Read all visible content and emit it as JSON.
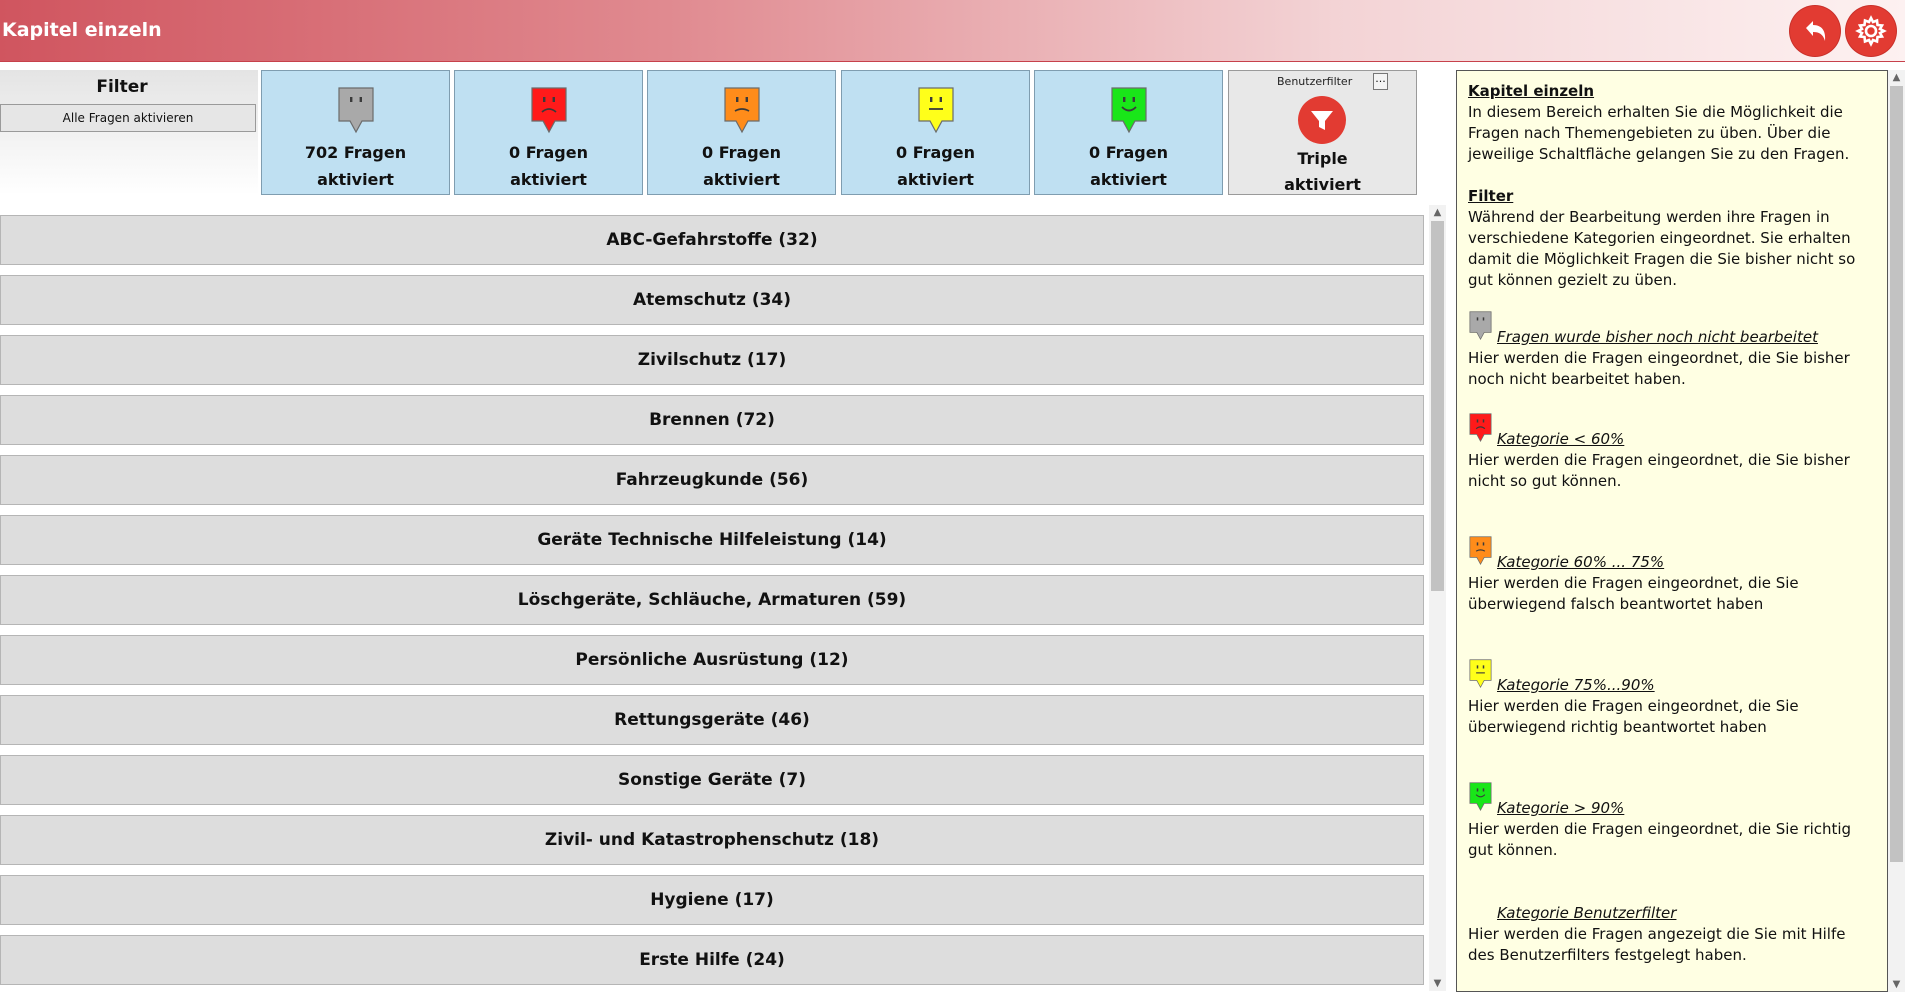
{
  "app": {
    "title": "Kapitel einzeln"
  },
  "filter": {
    "title": "Filter",
    "all_button": "Alle Fragen aktivieren",
    "tiles": [
      {
        "id": "gray",
        "color": "#a9a9a9",
        "mood": "neutral",
        "count": "702 Fragen",
        "status": "aktiviert"
      },
      {
        "id": "red",
        "color": "#ff1a1a",
        "mood": "sad",
        "count": "0 Fragen",
        "status": "aktiviert"
      },
      {
        "id": "orange",
        "color": "#ff8c1a",
        "mood": "meh",
        "count": "0 Fragen",
        "status": "aktiviert"
      },
      {
        "id": "yellow",
        "color": "#ffff1a",
        "mood": "flat",
        "count": "0 Fragen",
        "status": "aktiviert"
      },
      {
        "id": "green",
        "color": "#19e619",
        "mood": "happy",
        "count": "0 Fragen",
        "status": "aktiviert"
      }
    ],
    "user_filter": {
      "label": "Benutzerfilter",
      "more": "...",
      "count": "Triple",
      "status": "aktiviert",
      "icon": "funnel-icon"
    }
  },
  "chapters": [
    "ABC-Gefahrstoffe (32)",
    "Atemschutz (34)",
    "Zivilschutz (17)",
    "Brennen (72)",
    "Fahrzeugkunde (56)",
    "Geräte Technische Hilfeleistung (14)",
    "Löschgeräte, Schläuche, Armaturen (59)",
    "Persönliche Ausrüstung (12)",
    "Rettungsgeräte (46)",
    "Sonstige Geräte (7)",
    "Zivil- und Katastrophenschutz (18)",
    "Hygiene (17)",
    "Erste Hilfe (24)"
  ],
  "help": {
    "title": "Kapitel einzeln",
    "intro": "In diesem Bereich erhalten Sie die Möglichkeit die Fragen nach Themengebieten zu üben. Über die jeweilige Schaltfläche gelangen Sie zu den Fragen.",
    "filter_title": "Filter",
    "filter_text": "Während der Bearbeitung werden ihre Fragen in verschiedene Kategorien eingeordnet. Sie erhalten damit die Möglichkeit Fragen die Sie bisher nicht so gut können gezielt zu üben.",
    "categories": [
      {
        "color": "#a9a9a9",
        "mood": "neutral",
        "title": "Fragen wurde bisher noch nicht bearbeitet",
        "text": "Hier werden die Fragen eingeordnet, die Sie bisher noch nicht bearbeitet haben."
      },
      {
        "color": "#ff1a1a",
        "mood": "sad",
        "title": "Kategorie < 60%",
        "text": "Hier werden die Fragen eingeordnet, die Sie bisher nicht so gut können."
      },
      {
        "color": "#ff8c1a",
        "mood": "meh",
        "title": "Kategorie 60% ... 75%",
        "text": "Hier werden die Fragen eingeordnet, die Sie überwiegend falsch beantwortet haben"
      },
      {
        "color": "#ffff1a",
        "mood": "flat",
        "title": "Kategorie 75%...90%",
        "text": "Hier werden die Fragen eingeordnet, die Sie überwiegend richtig beantwortet haben"
      },
      {
        "color": "#19e619",
        "mood": "happy",
        "title": "Kategorie > 90%",
        "text": "Hier werden die Fragen eingeordnet, die Sie richtig gut können."
      },
      {
        "color": "",
        "mood": "none",
        "title": "Kategorie Benutzerfilter",
        "text": "Hier werden die Fragen angezeigt die Sie mit Hilfe des Benutzerfilters festgelegt haben."
      }
    ]
  },
  "colors": {
    "accent": "#e23b32",
    "tile_bg": "#bfe0f2",
    "help_bg": "#ffffe3"
  }
}
